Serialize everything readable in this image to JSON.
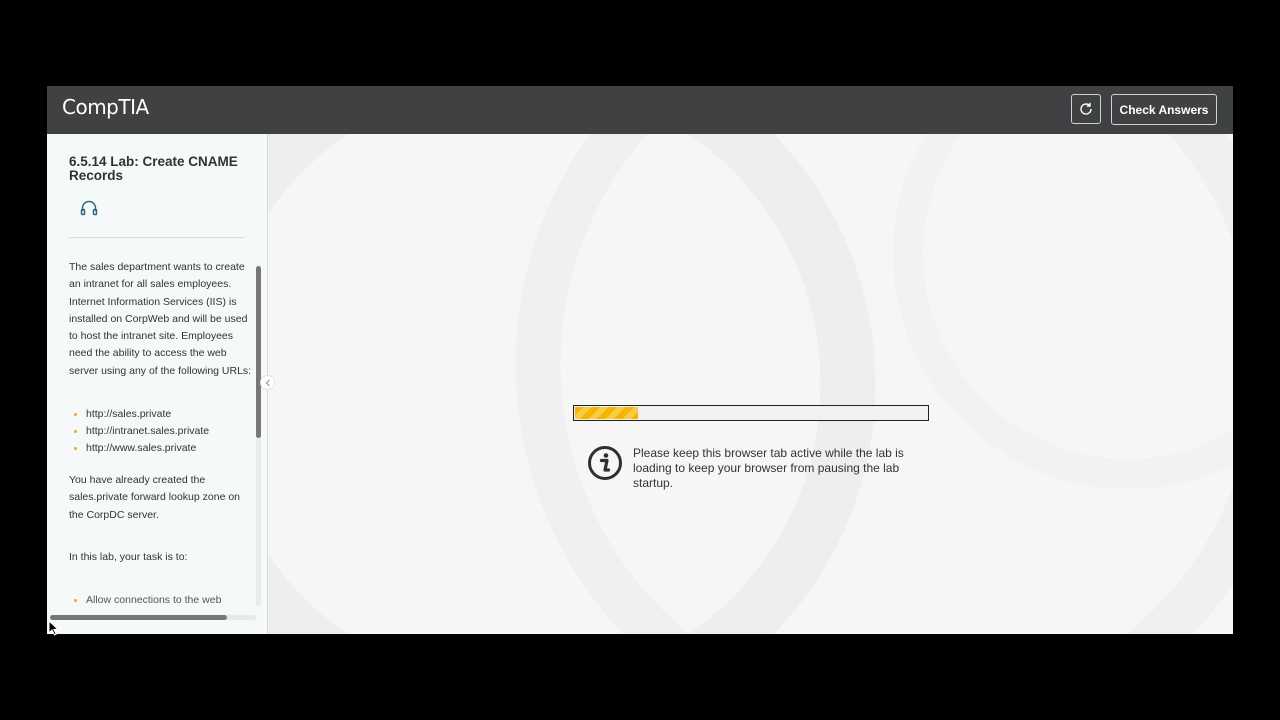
{
  "header": {
    "brand": "CompTIA",
    "check_answers_label": "Check Answers"
  },
  "sidebar": {
    "lab_title": "6.5.14 Lab: Create CNAME Records",
    "intro_paragraph": "The sales department wants to create an intranet for all sales employees. Internet Information Services (IIS) is installed on CorpWeb and will be used to host the intranet site. Employees need the ability to access the web server using any of the following URLs:",
    "urls": [
      "http://sales.private",
      "http://intranet.sales.private",
      "http://www.sales.private"
    ],
    "zone_paragraph": "You have already created the sales.private forward lookup zone on the CorpDC server.",
    "task_paragraph": "In this lab, your task is to:",
    "cut_off_item": "Allow connections to the web"
  },
  "main": {
    "progress": 0.18,
    "loading_message": "Please keep this browser tab active while the lab is loading to keep your browser from pausing the lab startup."
  },
  "colors": {
    "topbar": "#3f4142",
    "progress_fill": "#f4b400",
    "bullet": "#f5a623",
    "icon_teal": "#2a6b7c"
  }
}
